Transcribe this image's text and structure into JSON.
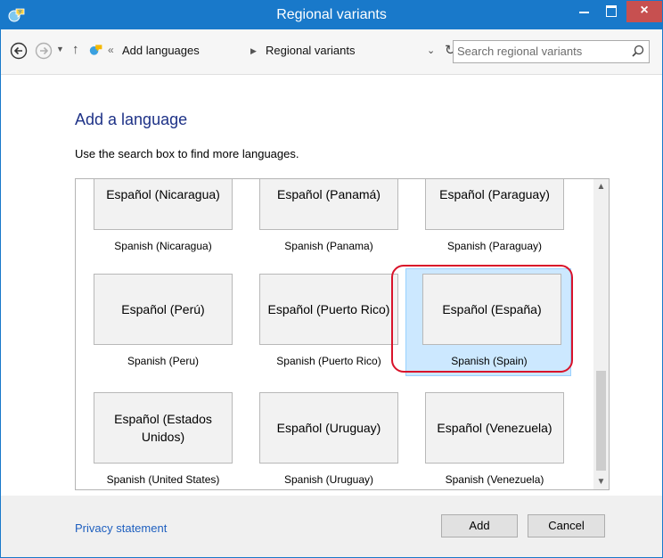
{
  "window": {
    "title": "Regional variants",
    "close_glyph": "×"
  },
  "nav": {
    "breadcrumb_sep": "«",
    "breadcrumbs": [
      "Add languages",
      "Regional variants"
    ],
    "arrow_glyph": "▶",
    "search_placeholder": "Search regional variants"
  },
  "main": {
    "heading": "Add a language",
    "description": "Use the search box to find more languages."
  },
  "languages": [
    {
      "native": "Español (Nicaragua)",
      "english": "Spanish (Nicaragua)",
      "selected": false
    },
    {
      "native": "Español (Panamá)",
      "english": "Spanish (Panama)",
      "selected": false
    },
    {
      "native": "Español (Paraguay)",
      "english": "Spanish (Paraguay)",
      "selected": false
    },
    {
      "native": "Español (Perú)",
      "english": "Spanish (Peru)",
      "selected": false
    },
    {
      "native": "Español (Puerto Rico)",
      "english": "Spanish (Puerto Rico)",
      "selected": false
    },
    {
      "native": "Español (España)",
      "english": "Spanish (Spain)",
      "selected": true
    },
    {
      "native": "Español (Estados Unidos)",
      "english": "Spanish (United States)",
      "selected": false
    },
    {
      "native": "Español (Uruguay)",
      "english": "Spanish (Uruguay)",
      "selected": false
    },
    {
      "native": "Español (Venezuela)",
      "english": "Spanish (Venezuela)",
      "selected": false
    }
  ],
  "footer": {
    "privacy_link": "Privacy statement",
    "add_label": "Add",
    "cancel_label": "Cancel"
  },
  "colors": {
    "titlebar": "#1979ca",
    "selection": "#cce8ff",
    "highlight_ring": "#d9132a",
    "link": "#1e5fbf"
  }
}
